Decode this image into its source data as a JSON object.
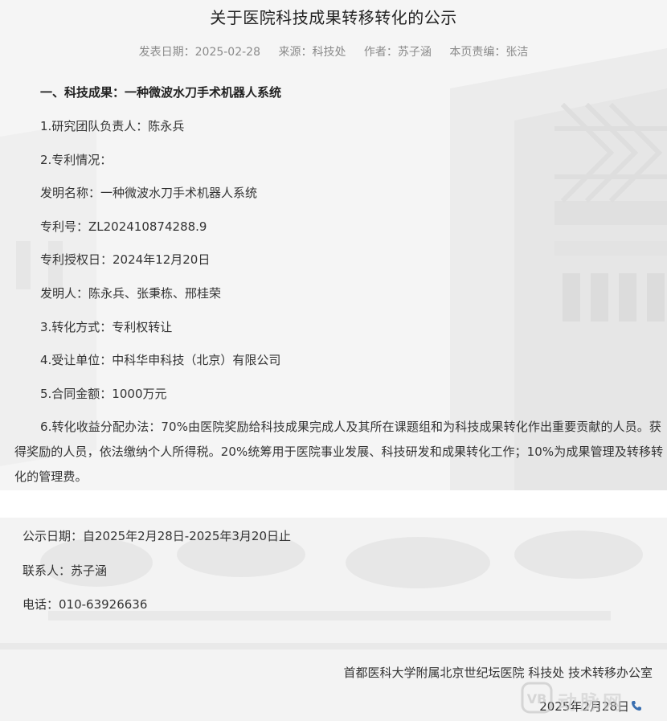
{
  "article": {
    "title": "关于医院科技成果转移转化的公示",
    "meta": {
      "date_label": "发表日期：2025-02-28",
      "source_label": "来源：科技处",
      "author_label": "作者：苏子涵",
      "editor_label": "本页责编：张洁"
    }
  },
  "body": {
    "heading": "一、科技成果：一种微波水刀手术机器人系统",
    "lines": [
      "1.研究团队负责人：陈永兵",
      "2.专利情况：",
      "发明名称：一种微波水刀手术机器人系统",
      "专利号：ZL202410874288.9",
      "专利授权日：2024年12月20日",
      "发明人：陈永兵、张秉栋、邢桂荣",
      "3.转化方式：专利权转让",
      "4.受让单位：中科华申科技（北京）有限公司",
      "5.合同金额：1000万元"
    ],
    "distribution": "6.转化收益分配办法：70%由医院奖励给科技成果完成人及其所在课题组和为科技成果转化作出重要贡献的人员。获得奖励的人员，依法缴纳个人所得税。20%统筹用于医院事业发展、科技研发和成果转化工作；10%为成果管理及转移转化的管理费。"
  },
  "notice": {
    "period": "公示日期：自2025年2月28日-2025年3月20日止",
    "contact": "联系人：苏子涵",
    "phone": "电话：010-63926636"
  },
  "signature": {
    "org": "首都医科大学附属北京世纪坛医院 科技处 技术转移办公室",
    "date": "2025年2月28日",
    "date_icon": "phone-icon"
  },
  "watermark": {
    "text": "动脉网",
    "logo": "vb-logo-icon"
  },
  "colors": {
    "text": "#333333",
    "meta": "#8a8a8a",
    "background": "#f4f4f4",
    "icon_blue": "#3a6fb0"
  }
}
